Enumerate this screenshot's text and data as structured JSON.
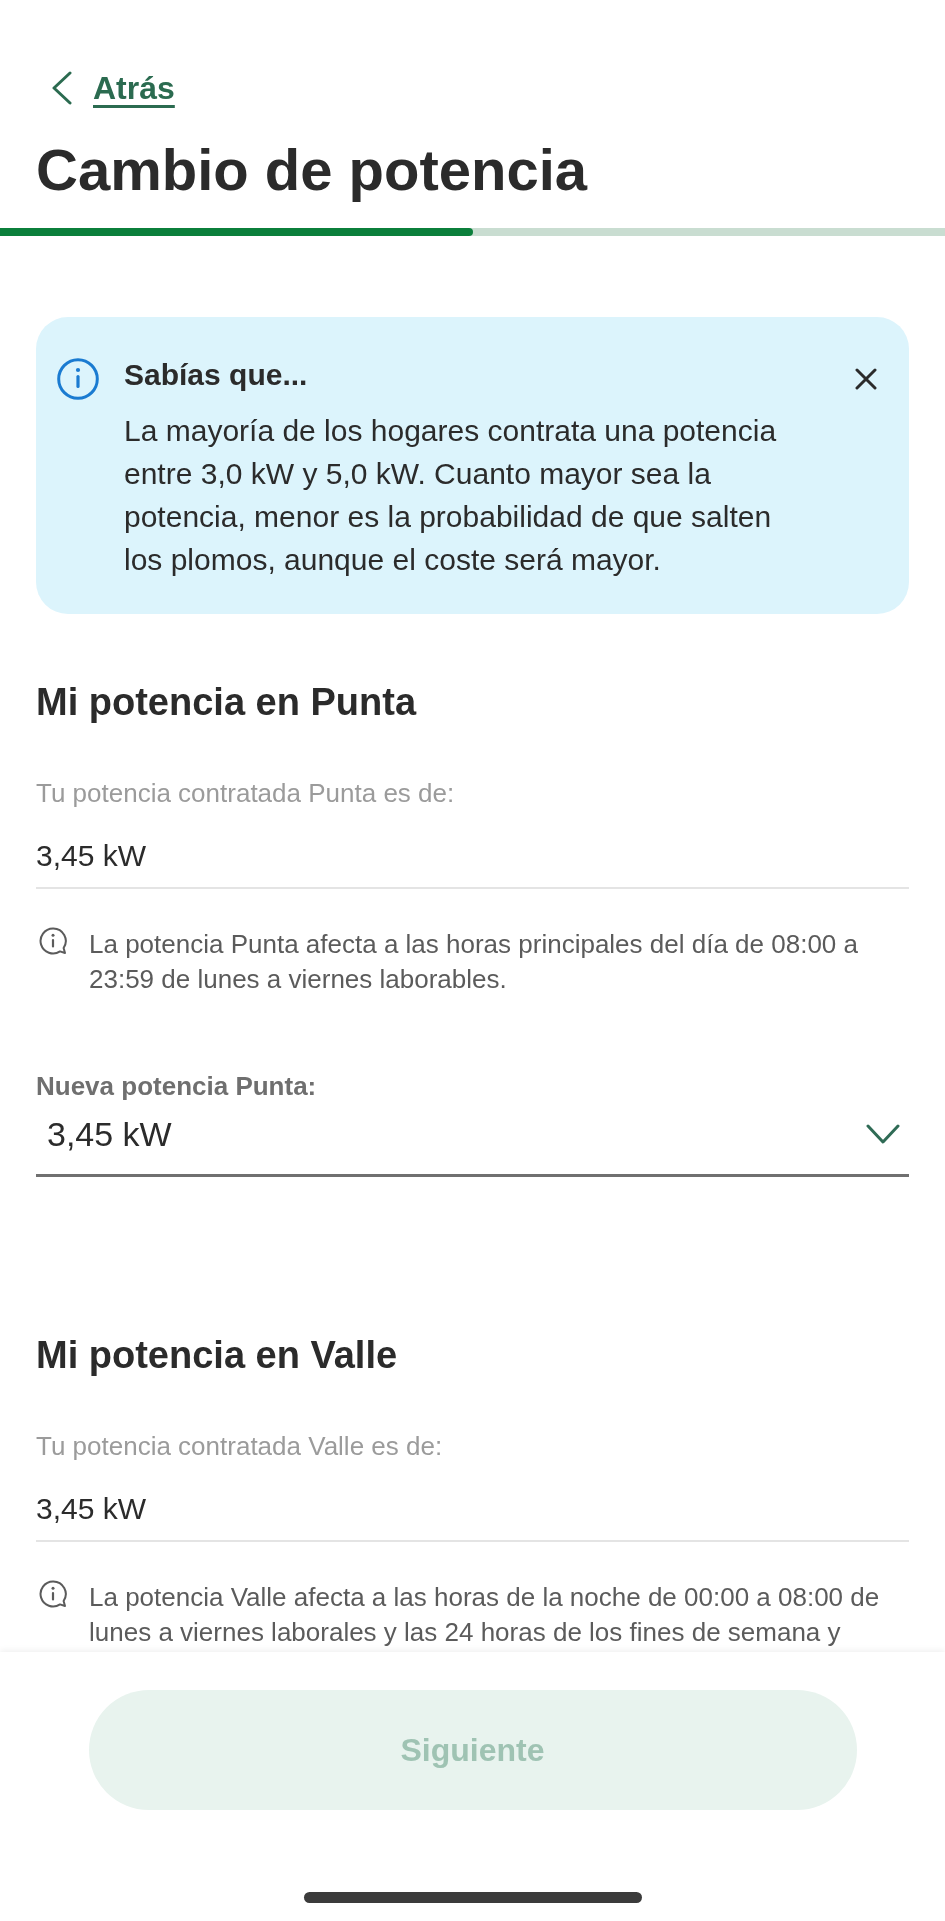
{
  "back_link": {
    "label": "Atrás"
  },
  "title": "Cambio de potencia",
  "progress": {
    "level": 0.5
  },
  "info_banner": {
    "title": "Sabías que...",
    "text": "La mayoría de los hogares contrata una potencia entre 3,0 kW y 5,0 kW. Cuanto mayor sea la potencia, menor es la probabilidad de que salten los plomos, aunque el coste será mayor."
  },
  "sections": [
    {
      "heading": "Mi potencia en Punta",
      "current_label": "Tu potencia contratada Punta es de:",
      "current_value": "3,45 kW",
      "note": "La potencia Punta afecta a las horas principales del día de 08:00 a 23:59 de lunes a viernes laborables.",
      "select": {
        "label": "Nueva potencia Punta:",
        "value": "3,45 kW"
      }
    },
    {
      "heading": "Mi potencia en Valle",
      "current_label": "Tu potencia contratada Valle es de:",
      "current_value": "3,45 kW",
      "note": "La potencia Valle afecta a las horas de la noche de 00:00 a 08:00 de lunes a viernes laborales y las 24 horas de los fines de semana y"
    }
  ],
  "next_button": {
    "label": "Siguiente",
    "disabled": true
  }
}
